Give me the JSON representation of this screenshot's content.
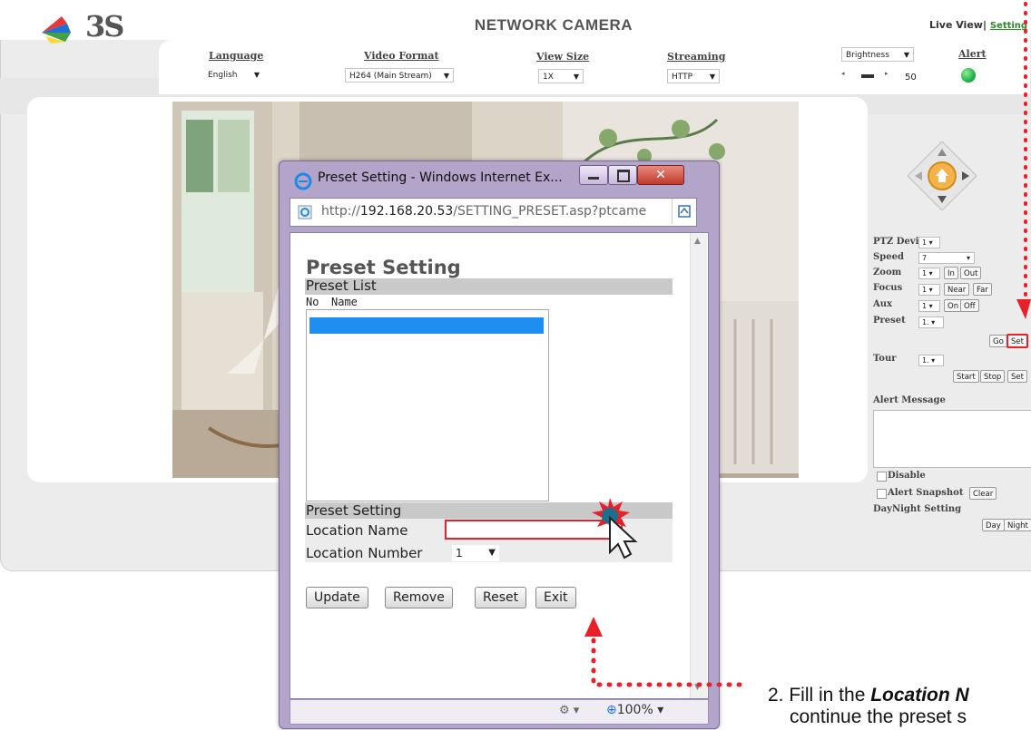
{
  "header": {
    "logo_text": "3S",
    "title": "NETWORK CAMERA",
    "live_view": "Live View",
    "separator": "|",
    "setting": "Setting"
  },
  "toolbar": {
    "language": {
      "label": "Language",
      "value": "English"
    },
    "video_format": {
      "label": "Video Format",
      "value": "H264 (Main Stream)"
    },
    "view_size": {
      "label": "View Size",
      "value": "1X"
    },
    "streaming": {
      "label": "Streaming",
      "value": "HTTP"
    },
    "brightness": {
      "value": "Brightness",
      "level": "50"
    },
    "alert": {
      "label": "Alert",
      "status_color": "#22b14c"
    }
  },
  "ptz": {
    "device_label": "PTZ Device",
    "device_value": "1",
    "speed_label": "Speed",
    "speed_value": "7",
    "zoom_label": "Zoom",
    "zoom_value": "1",
    "zoom_in": "In",
    "zoom_out": "Out",
    "focus_label": "Focus",
    "focus_value": "1",
    "focus_near": "Near",
    "focus_far": "Far",
    "aux_label": "Aux",
    "aux_value": "1",
    "aux_on": "On",
    "aux_off": "Off",
    "preset_label": "Preset",
    "preset_value": "1.",
    "preset_go": "Go",
    "preset_set": "Set",
    "tour_label": "Tour",
    "tour_value": "1.",
    "tour_start": "Start",
    "tour_stop": "Stop",
    "tour_set": "Set"
  },
  "alert_panel": {
    "message_label": "Alert Message",
    "disable_label": "Disable",
    "snapshot_label": "Alert Snapshot",
    "clear": "Clear",
    "daynight_label": "DayNight Setting",
    "day": "Day",
    "night": "Night"
  },
  "popup": {
    "window_title": "Preset Setting - Windows Internet Ex...",
    "url_prefix": "http://",
    "url_host": "192.168.20.53",
    "url_path": "/SETTING_PRESET.asp?ptcame",
    "heading": "Preset Setting",
    "list_header": "Preset List",
    "col_no": "No",
    "col_name": "Name",
    "setting_header": "Preset Setting",
    "location_name_label": "Location Name",
    "location_name_value": "",
    "location_number_label": "Location Number",
    "location_number_value": "1",
    "buttons": {
      "update": "Update",
      "remove": "Remove",
      "reset": "Reset",
      "exit": "Exit"
    },
    "zoom": "100%"
  },
  "annotation": {
    "line1_prefix": "2.  Fill in the ",
    "line1_emph": "Location N",
    "line2": "continue the preset s"
  },
  "colors": {
    "highlight_red": "#e8202a",
    "selection_blue": "#1e8ef0",
    "link_green": "#2a8a2a"
  }
}
